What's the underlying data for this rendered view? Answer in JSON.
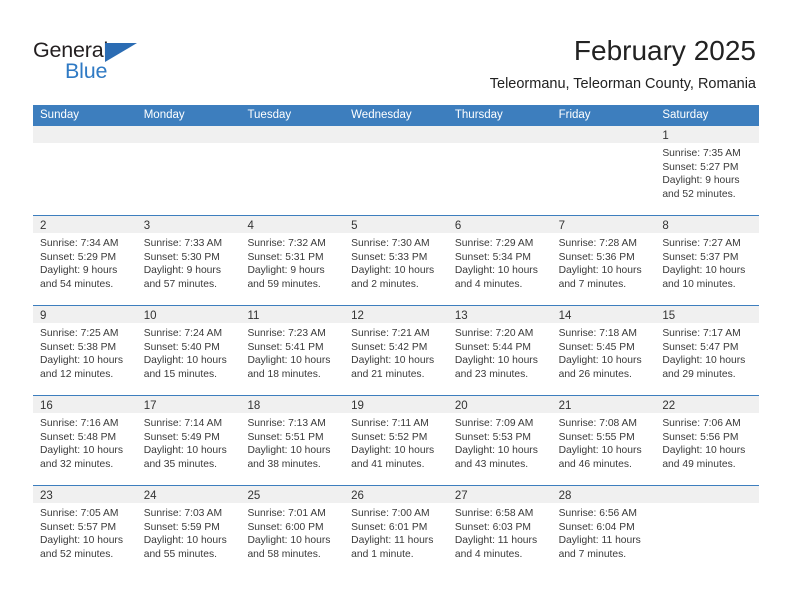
{
  "brand": {
    "name_top": "General",
    "name_bottom": "Blue",
    "triangle_color": "#2b6cb3",
    "text_color_top": "#231f20",
    "text_color_bottom": "#2f7ac4"
  },
  "header": {
    "title": "February 2025",
    "subtitle": "Teleormanu, Teleorman County, Romania"
  },
  "theme": {
    "header_blue": "#3d7ebe",
    "daynum_band": "#f0f0f0",
    "text": "#333333"
  },
  "weekdays": [
    "Sunday",
    "Monday",
    "Tuesday",
    "Wednesday",
    "Thursday",
    "Friday",
    "Saturday"
  ],
  "labels": {
    "sunrise": "Sunrise:",
    "sunset": "Sunset:",
    "daylight": "Daylight:"
  },
  "weeks": [
    [
      {
        "day": "",
        "empty": true
      },
      {
        "day": "",
        "empty": true
      },
      {
        "day": "",
        "empty": true
      },
      {
        "day": "",
        "empty": true
      },
      {
        "day": "",
        "empty": true
      },
      {
        "day": "",
        "empty": true
      },
      {
        "day": "1",
        "sunrise": "Sunrise: 7:35 AM",
        "sunset": "Sunset: 5:27 PM",
        "daylight": "Daylight: 9 hours and 52 minutes."
      }
    ],
    [
      {
        "day": "2",
        "sunrise": "Sunrise: 7:34 AM",
        "sunset": "Sunset: 5:29 PM",
        "daylight": "Daylight: 9 hours and 54 minutes."
      },
      {
        "day": "3",
        "sunrise": "Sunrise: 7:33 AM",
        "sunset": "Sunset: 5:30 PM",
        "daylight": "Daylight: 9 hours and 57 minutes."
      },
      {
        "day": "4",
        "sunrise": "Sunrise: 7:32 AM",
        "sunset": "Sunset: 5:31 PM",
        "daylight": "Daylight: 9 hours and 59 minutes."
      },
      {
        "day": "5",
        "sunrise": "Sunrise: 7:30 AM",
        "sunset": "Sunset: 5:33 PM",
        "daylight": "Daylight: 10 hours and 2 minutes."
      },
      {
        "day": "6",
        "sunrise": "Sunrise: 7:29 AM",
        "sunset": "Sunset: 5:34 PM",
        "daylight": "Daylight: 10 hours and 4 minutes."
      },
      {
        "day": "7",
        "sunrise": "Sunrise: 7:28 AM",
        "sunset": "Sunset: 5:36 PM",
        "daylight": "Daylight: 10 hours and 7 minutes."
      },
      {
        "day": "8",
        "sunrise": "Sunrise: 7:27 AM",
        "sunset": "Sunset: 5:37 PM",
        "daylight": "Daylight: 10 hours and 10 minutes."
      }
    ],
    [
      {
        "day": "9",
        "sunrise": "Sunrise: 7:25 AM",
        "sunset": "Sunset: 5:38 PM",
        "daylight": "Daylight: 10 hours and 12 minutes."
      },
      {
        "day": "10",
        "sunrise": "Sunrise: 7:24 AM",
        "sunset": "Sunset: 5:40 PM",
        "daylight": "Daylight: 10 hours and 15 minutes."
      },
      {
        "day": "11",
        "sunrise": "Sunrise: 7:23 AM",
        "sunset": "Sunset: 5:41 PM",
        "daylight": "Daylight: 10 hours and 18 minutes."
      },
      {
        "day": "12",
        "sunrise": "Sunrise: 7:21 AM",
        "sunset": "Sunset: 5:42 PM",
        "daylight": "Daylight: 10 hours and 21 minutes."
      },
      {
        "day": "13",
        "sunrise": "Sunrise: 7:20 AM",
        "sunset": "Sunset: 5:44 PM",
        "daylight": "Daylight: 10 hours and 23 minutes."
      },
      {
        "day": "14",
        "sunrise": "Sunrise: 7:18 AM",
        "sunset": "Sunset: 5:45 PM",
        "daylight": "Daylight: 10 hours and 26 minutes."
      },
      {
        "day": "15",
        "sunrise": "Sunrise: 7:17 AM",
        "sunset": "Sunset: 5:47 PM",
        "daylight": "Daylight: 10 hours and 29 minutes."
      }
    ],
    [
      {
        "day": "16",
        "sunrise": "Sunrise: 7:16 AM",
        "sunset": "Sunset: 5:48 PM",
        "daylight": "Daylight: 10 hours and 32 minutes."
      },
      {
        "day": "17",
        "sunrise": "Sunrise: 7:14 AM",
        "sunset": "Sunset: 5:49 PM",
        "daylight": "Daylight: 10 hours and 35 minutes."
      },
      {
        "day": "18",
        "sunrise": "Sunrise: 7:13 AM",
        "sunset": "Sunset: 5:51 PM",
        "daylight": "Daylight: 10 hours and 38 minutes."
      },
      {
        "day": "19",
        "sunrise": "Sunrise: 7:11 AM",
        "sunset": "Sunset: 5:52 PM",
        "daylight": "Daylight: 10 hours and 41 minutes."
      },
      {
        "day": "20",
        "sunrise": "Sunrise: 7:09 AM",
        "sunset": "Sunset: 5:53 PM",
        "daylight": "Daylight: 10 hours and 43 minutes."
      },
      {
        "day": "21",
        "sunrise": "Sunrise: 7:08 AM",
        "sunset": "Sunset: 5:55 PM",
        "daylight": "Daylight: 10 hours and 46 minutes."
      },
      {
        "day": "22",
        "sunrise": "Sunrise: 7:06 AM",
        "sunset": "Sunset: 5:56 PM",
        "daylight": "Daylight: 10 hours and 49 minutes."
      }
    ],
    [
      {
        "day": "23",
        "sunrise": "Sunrise: 7:05 AM",
        "sunset": "Sunset: 5:57 PM",
        "daylight": "Daylight: 10 hours and 52 minutes."
      },
      {
        "day": "24",
        "sunrise": "Sunrise: 7:03 AM",
        "sunset": "Sunset: 5:59 PM",
        "daylight": "Daylight: 10 hours and 55 minutes."
      },
      {
        "day": "25",
        "sunrise": "Sunrise: 7:01 AM",
        "sunset": "Sunset: 6:00 PM",
        "daylight": "Daylight: 10 hours and 58 minutes."
      },
      {
        "day": "26",
        "sunrise": "Sunrise: 7:00 AM",
        "sunset": "Sunset: 6:01 PM",
        "daylight": "Daylight: 11 hours and 1 minute."
      },
      {
        "day": "27",
        "sunrise": "Sunrise: 6:58 AM",
        "sunset": "Sunset: 6:03 PM",
        "daylight": "Daylight: 11 hours and 4 minutes."
      },
      {
        "day": "28",
        "sunrise": "Sunrise: 6:56 AM",
        "sunset": "Sunset: 6:04 PM",
        "daylight": "Daylight: 11 hours and 7 minutes."
      },
      {
        "day": "",
        "empty": true
      }
    ]
  ]
}
